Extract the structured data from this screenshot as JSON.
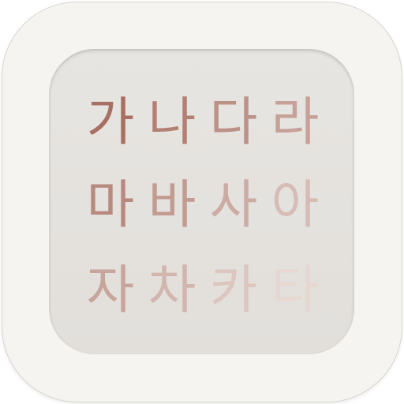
{
  "icon": {
    "rows": [
      {
        "glyphs": [
          "가",
          "나",
          "다",
          "라"
        ]
      },
      {
        "glyphs": [
          "마",
          "바",
          "사",
          "아"
        ]
      },
      {
        "glyphs": [
          "자",
          "차",
          "카",
          "타"
        ]
      }
    ],
    "colors": {
      "frame": "#f5f4f1",
      "panel": "#e4e1dd",
      "glyph_strong": "#a86f63",
      "glyph_faded": "#e6d8d2"
    }
  }
}
